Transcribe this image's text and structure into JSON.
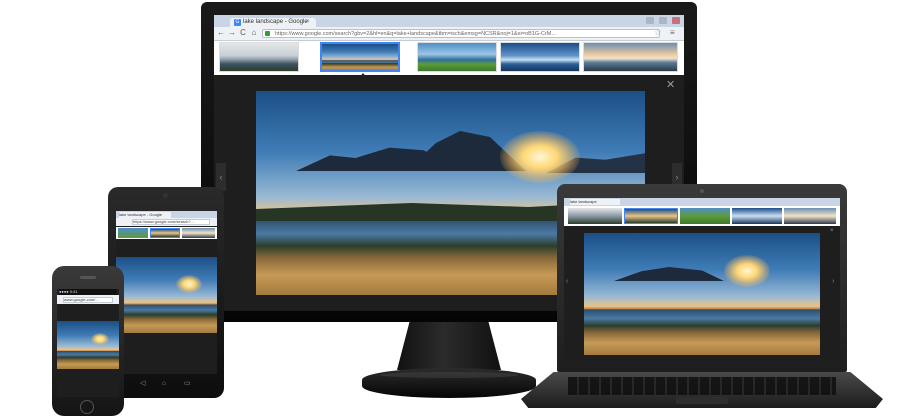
{
  "browser": {
    "tab_title": "lake landscape - Google",
    "tab_favicon": "G",
    "close_tab": "×",
    "url": "https://www.google.com/search?gbv=2&hl=en&q=lake+landscape&tbm=isch&emsg=NCSR&noj=1&ei=oB1G-CrM...",
    "nav": {
      "back": "←",
      "forward": "→",
      "reload": "C",
      "home": "⌂"
    },
    "star": "☆",
    "menu": "≡"
  },
  "viewer": {
    "close": "✕",
    "prev": "‹",
    "next": "›"
  },
  "tablet": {
    "tab_title": "lake landscape - Google",
    "url": "https://www.google.com/search?...",
    "softkeys": {
      "back": "◁",
      "home": "⌂",
      "recent": "▭"
    }
  },
  "phone": {
    "status": "●●●●  9:41",
    "url": "www.google.com/..."
  },
  "laptop": {
    "tab_title": "lake landscape",
    "close": "×",
    "prev": "‹",
    "next": "›"
  },
  "colors": {
    "accent": "#4285f4",
    "frame": "#111111",
    "viewer_bg": "#1e1e1e"
  }
}
